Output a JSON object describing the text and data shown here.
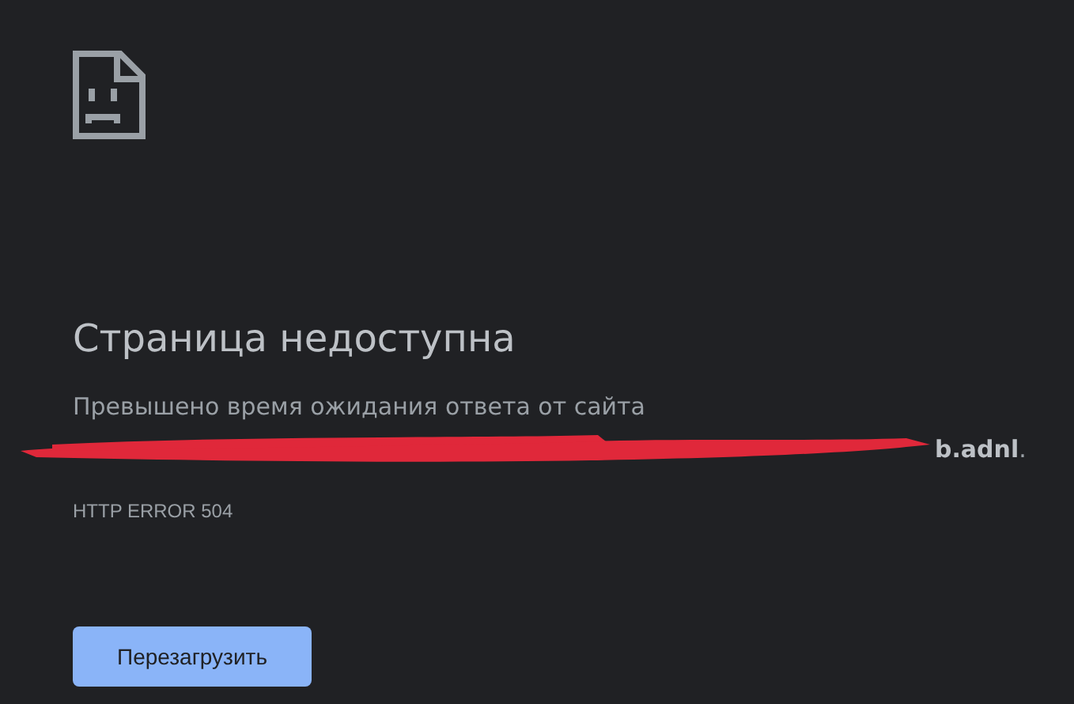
{
  "error_page": {
    "title": "Страница недоступна",
    "message": "Превышено время ожидания ответа от сайта",
    "url": "**b.adnl**.",
    "error_code": "HTTP ERROR 504",
    "reload_button": "Перезагрузить"
  }
}
